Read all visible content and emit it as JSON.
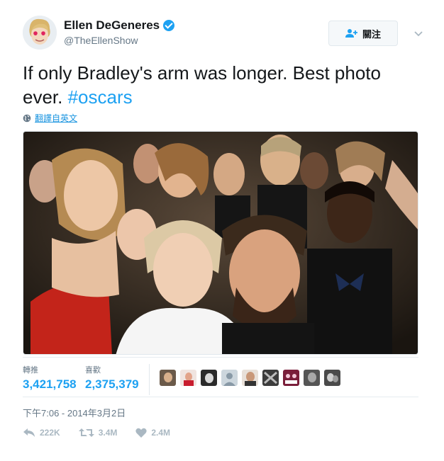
{
  "user": {
    "display_name": "Ellen DeGeneres",
    "handle": "@TheEllenShow",
    "verified": true
  },
  "follow_button": {
    "label": "關注",
    "icon": "add-user-icon"
  },
  "more_icon": "chevron-down-icon",
  "tweet": {
    "text": "If only Bradley's arm was longer. Best photo ever. ",
    "hashtag": "#oscars"
  },
  "translate": {
    "label": "翻譯自英文",
    "icon": "globe-icon"
  },
  "stats": {
    "retweets_label": "轉推",
    "retweets_value": "3,421,758",
    "likes_label": "喜歡",
    "likes_value": "2,375,379"
  },
  "likers": [
    {
      "name": "liker-1"
    },
    {
      "name": "liker-2"
    },
    {
      "name": "liker-3"
    },
    {
      "name": "liker-4"
    },
    {
      "name": "liker-5"
    },
    {
      "name": "liker-6"
    },
    {
      "name": "liker-7"
    },
    {
      "name": "liker-8"
    },
    {
      "name": "liker-9"
    }
  ],
  "timestamp": "下午7:06 - 2014年3月2日",
  "actions": {
    "reply_count": "222K",
    "retweet_count": "3.4M",
    "like_count": "2.4M"
  },
  "colors": {
    "accent": "#1da1f2",
    "text": "#14171a",
    "muted": "#657786",
    "action": "#aab8c2"
  }
}
